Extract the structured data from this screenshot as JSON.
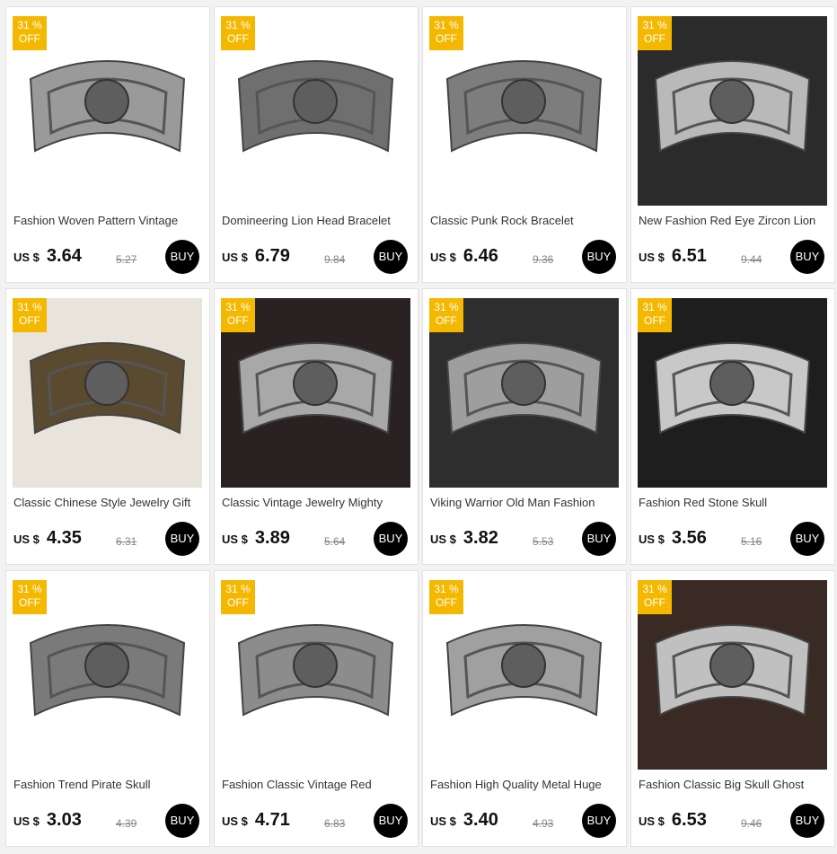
{
  "currency_label": "US $",
  "buy_label": "BUY",
  "badge": {
    "line1": "31 %",
    "line2": "OFF"
  },
  "colors": {
    "badge": "#f5b800",
    "buy_button": "#000000",
    "price": "#111111"
  },
  "products": [
    {
      "title": "Fashion Woven Pattern Vintage",
      "price": "3.64",
      "old_price": "5.27",
      "image": "silver-chain-cuff-bracelet",
      "bg": "#ffffff",
      "tone": "#9a9a9a"
    },
    {
      "title": "Domineering Lion Head Bracelet",
      "price": "6.79",
      "old_price": "9.84",
      "image": "lion-head-cuff-bracelet",
      "bg": "#ffffff",
      "tone": "#6f6f6f"
    },
    {
      "title": "Classic Punk Rock Bracelet",
      "price": "6.46",
      "old_price": "9.36",
      "image": "dragon-cuff-bracelet",
      "bg": "#ffffff",
      "tone": "#7d7d7d"
    },
    {
      "title": "New Fashion Red Eye Zircon Lion",
      "price": "6.51",
      "old_price": "9.44",
      "image": "lion-ring-bracelet-on-hand",
      "bg": "#2b2b2b",
      "tone": "#b9b9b9"
    },
    {
      "title": "Classic Chinese Style Jewelry Gift",
      "price": "4.35",
      "old_price": "6.31",
      "image": "chinese-style-cuff-on-rope",
      "bg": "#e8e4dc",
      "tone": "#5a4a30"
    },
    {
      "title": "Classic Vintage Jewelry Mighty",
      "price": "3.89",
      "old_price": "5.64",
      "image": "tiger-cuff-bracelet",
      "bg": "#2a2222",
      "tone": "#a8a8a8"
    },
    {
      "title": "Viking Warrior Old Man Fashion",
      "price": "3.82",
      "old_price": "5.53",
      "image": "viking-face-cuff-bracelet",
      "bg": "#2e2e2e",
      "tone": "#9e9e9e"
    },
    {
      "title": "Fashion Red Stone Skull",
      "price": "3.56",
      "old_price": "5.16",
      "image": "skull-cuff-on-hand",
      "bg": "#1e1e1e",
      "tone": "#c8c8c8"
    },
    {
      "title": "Fashion Trend Pirate Skull",
      "price": "3.03",
      "old_price": "4.39",
      "image": "pirate-skull-cuff",
      "bg": "#ffffff",
      "tone": "#7a7a7a"
    },
    {
      "title": "Fashion Classic Vintage Red",
      "price": "4.71",
      "old_price": "6.83",
      "image": "red-stone-cuff",
      "bg": "#ffffff",
      "tone": "#8c8c8c"
    },
    {
      "title": "Fashion High Quality Metal Huge",
      "price": "3.40",
      "old_price": "4.93",
      "image": "huge-skull-bracelet-on-wrist",
      "bg": "#ffffff",
      "tone": "#a0a0a0"
    },
    {
      "title": "Fashion Classic Big Skull Ghost",
      "price": "6.53",
      "old_price": "9.46",
      "image": "ghost-skull-bracelet-on-wrist",
      "bg": "#3a2a24",
      "tone": "#c0c0c0"
    }
  ]
}
